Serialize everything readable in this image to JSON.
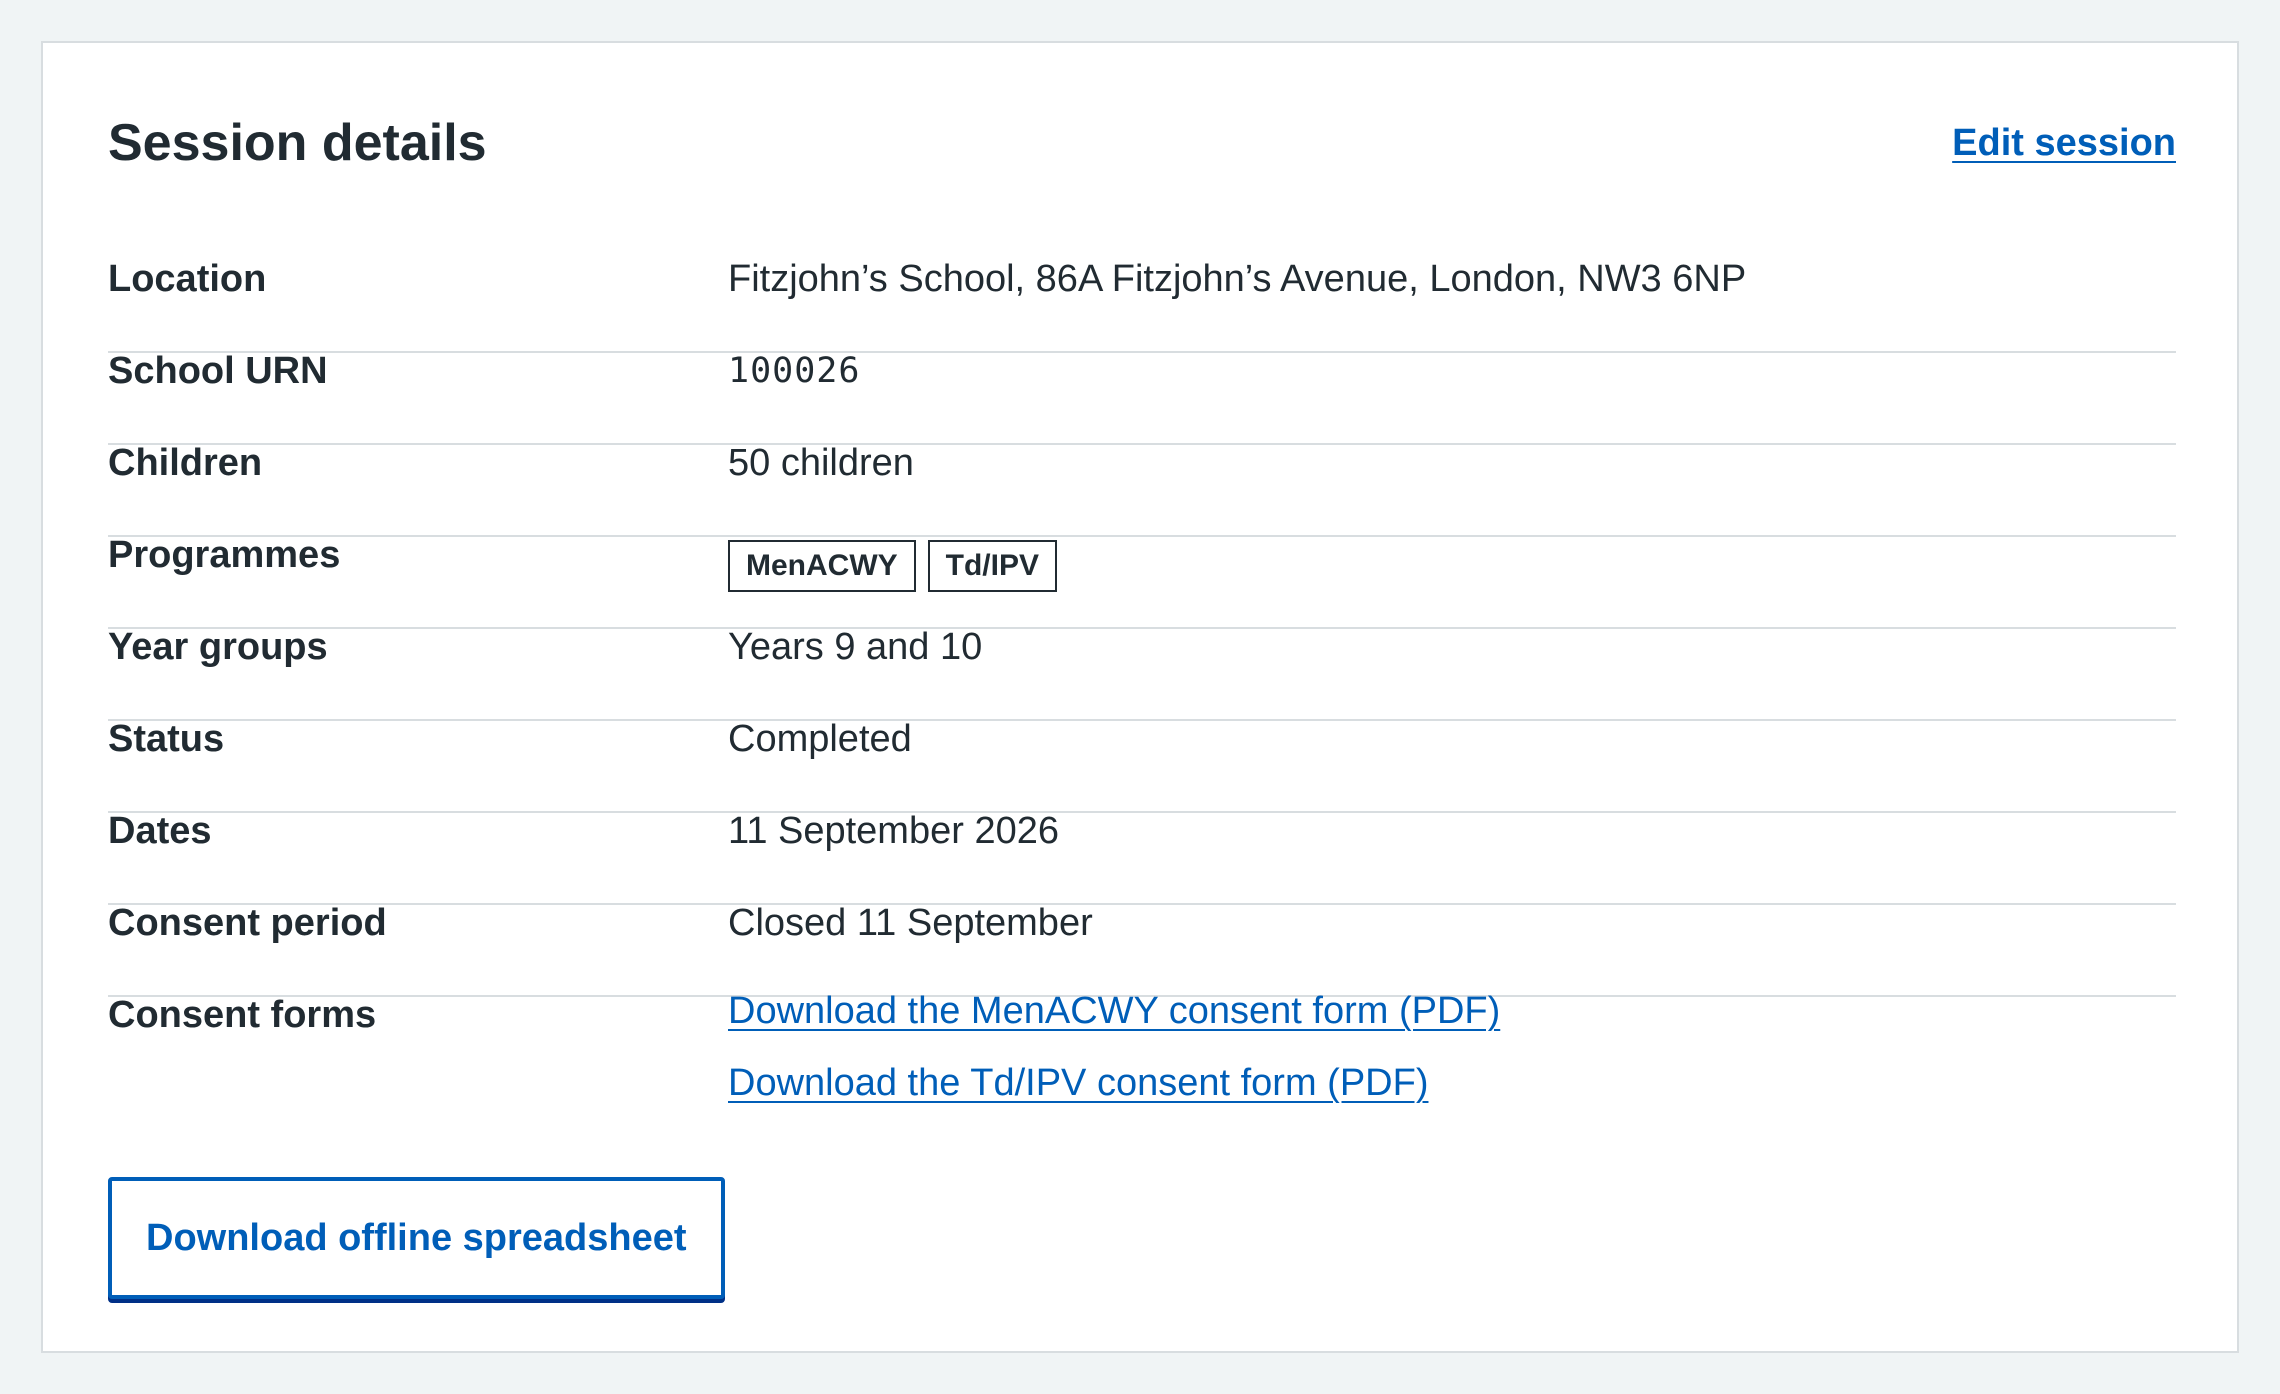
{
  "card": {
    "title": "Session details",
    "edit_link": "Edit session"
  },
  "summary": {
    "rows": [
      {
        "key": "Location",
        "value": "Fitzjohn’s School, 86A Fitzjohn’s Avenue, London, NW3 6NP"
      },
      {
        "key": "School URN",
        "value": "100026"
      },
      {
        "key": "Children",
        "value": "50 children"
      },
      {
        "key": "Programmes",
        "tags": [
          "MenACWY",
          "Td/IPV"
        ]
      },
      {
        "key": "Year groups",
        "value": "Years 9 and 10"
      },
      {
        "key": "Status",
        "value": "Completed"
      },
      {
        "key": "Dates",
        "value": "11 September 2026"
      },
      {
        "key": "Consent period",
        "value": "Closed 11 September"
      },
      {
        "key": "Consent forms",
        "links": [
          "Download the MenACWY consent form (PDF)",
          "Download the Td/IPV consent form (PDF)"
        ]
      }
    ]
  },
  "actions": {
    "download_button": "Download offline spreadsheet"
  },
  "colors": {
    "page_background": "#f0f4f5",
    "text": "#212b32",
    "link": "#005eb8",
    "border": "#d8dde0"
  }
}
